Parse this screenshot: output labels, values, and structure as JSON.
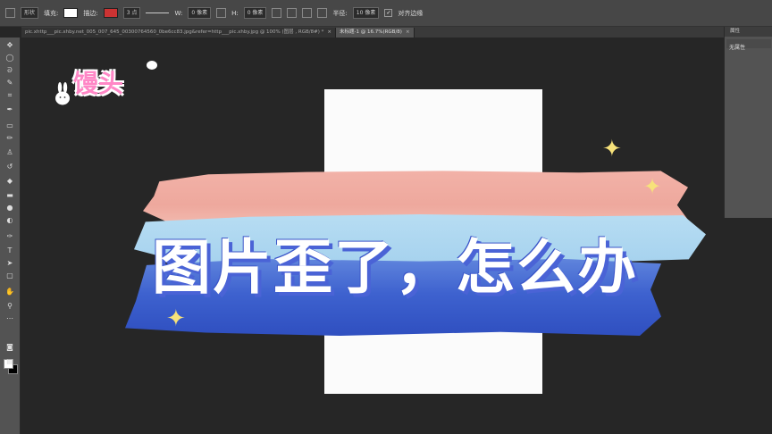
{
  "options_bar": {
    "mode": "形状",
    "fill_label": "填充:",
    "stroke_label": "描边:",
    "stroke_width": "3 点",
    "w_label": "W:",
    "w_value": "0 像素",
    "h_label": "H:",
    "h_value": "0 像素",
    "radius_label": "半径:",
    "radius_value": "10 像素",
    "align_label": "对齐边缘"
  },
  "tabs": [
    {
      "label": "pic.xhttp___pic.xhby.net_005_007_645_00300764560_0be6cc83.jpg&refer=http___pic.xhby.jpg @ 100% (图层 , RGB/8#) *",
      "active": false
    },
    {
      "label": "未标题-1 @ 16.7%(RGB/8)",
      "active": true
    }
  ],
  "panel": {
    "title": "属性",
    "content": "无属性"
  },
  "canvas": {
    "headline": "图片歪了，怎么办",
    "logo": "馒头"
  },
  "colors": {
    "pink_stroke": "#eea89d",
    "light_blue_stroke": "#a6d2ee",
    "blue_stroke": "#3e62cf",
    "headline_shadow": "#4a63d6",
    "logo_pink": "#ff87c6",
    "sparkle": "#f7e27a"
  },
  "icons": [
    "move-icon",
    "marquee-icon",
    "lasso-icon",
    "quick-select-icon",
    "crop-icon",
    "eyedropper-icon",
    "healing-icon",
    "brush-icon",
    "clone-stamp-icon",
    "history-brush-icon",
    "eraser-icon",
    "gradient-icon",
    "blur-icon",
    "dodge-icon",
    "pen-icon",
    "type-icon",
    "path-select-icon",
    "shape-icon",
    "hand-icon",
    "zoom-icon"
  ]
}
